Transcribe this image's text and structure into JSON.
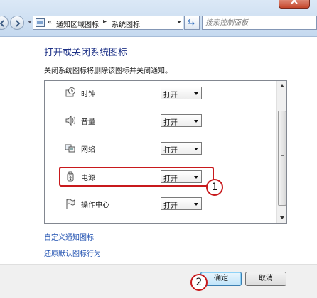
{
  "nav": {
    "back_icon": "back-arrow-icon",
    "forward_icon": "forward-arrow-icon",
    "breadcrumb_prefix": "«",
    "breadcrumb": [
      "通知区域图标",
      "系统图标"
    ],
    "separator": "▸",
    "refresh_icon": "refresh-icon",
    "search_placeholder": "搜索控制面板"
  },
  "page": {
    "title": "打开或关闭系统图标",
    "description": "关闭系统图标将删除该图标并关闭通知。"
  },
  "icons": [
    {
      "label": "时钟",
      "icon": "clock-icon",
      "value": "打开"
    },
    {
      "label": "音量",
      "icon": "volume-icon",
      "value": "打开"
    },
    {
      "label": "网络",
      "icon": "network-icon",
      "value": "打开"
    },
    {
      "label": "电源",
      "icon": "power-icon",
      "value": "打开"
    },
    {
      "label": "操作中心",
      "icon": "action-center-flag-icon",
      "value": "打开"
    }
  ],
  "links": {
    "customize": "自定义通知图标",
    "restore": "还原默认图标行为"
  },
  "buttons": {
    "ok": "确定",
    "cancel": "取消"
  },
  "callouts": {
    "first": "1",
    "second": "2"
  },
  "colors": {
    "highlight": "#c8191c",
    "title": "#1e3287",
    "link": "#1e4fb0"
  }
}
